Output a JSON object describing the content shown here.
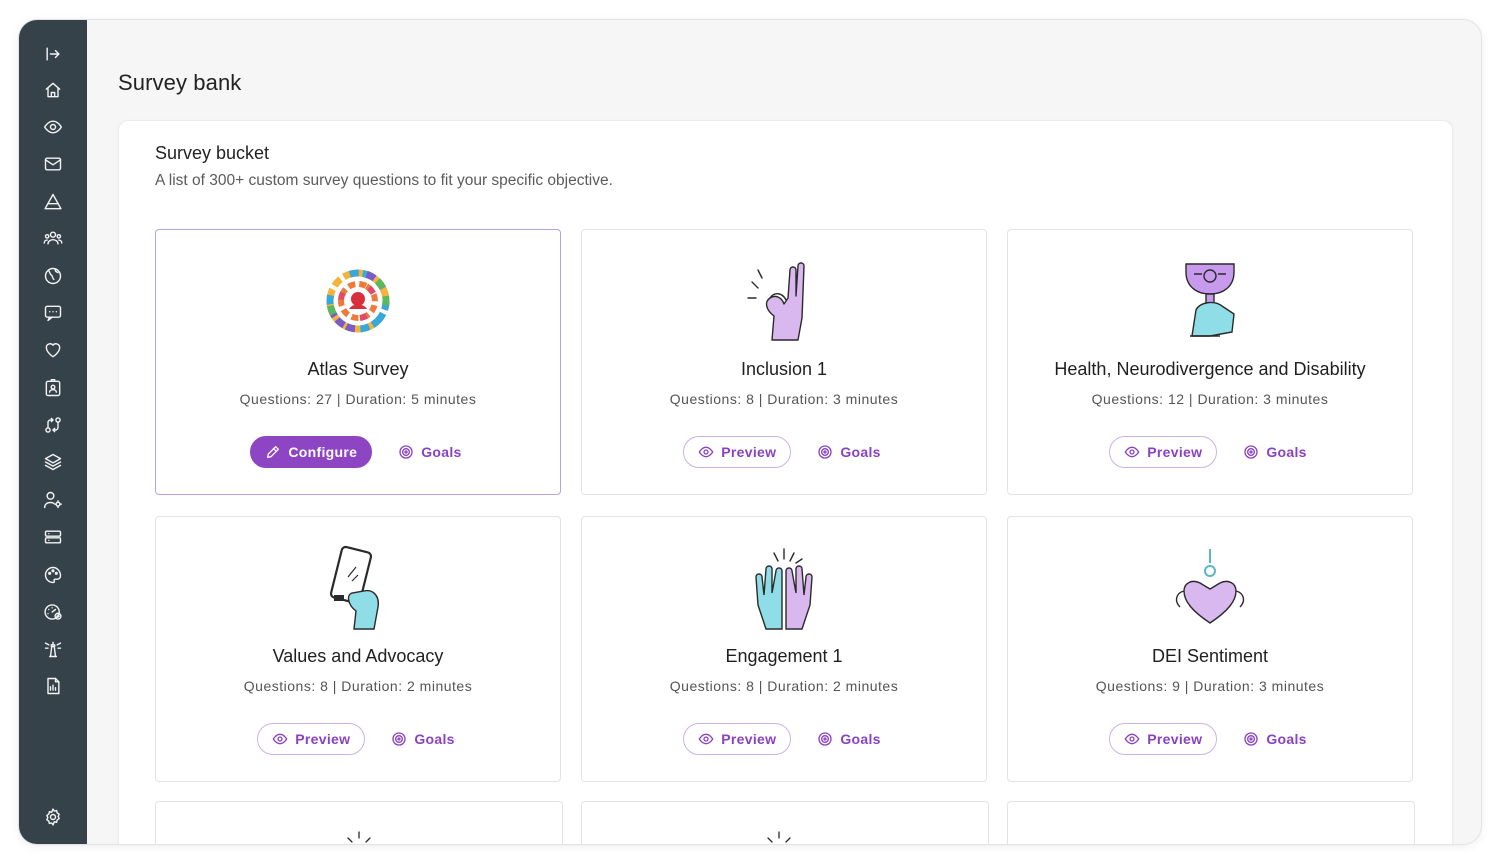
{
  "page": {
    "title": "Survey bank"
  },
  "panel": {
    "title": "Survey bucket",
    "subtitle": "A list of 300+ custom survey questions to fit your specific objective."
  },
  "colors": {
    "sidebar": "#36424a",
    "accent": "#8e45c4",
    "accent_outline": "#c9b3e6"
  },
  "sidebar": {
    "items": [
      {
        "icon": "expand-sidebar-icon"
      },
      {
        "icon": "home-icon"
      },
      {
        "icon": "eye-icon"
      },
      {
        "icon": "mail-icon"
      },
      {
        "icon": "triangle-icon"
      },
      {
        "icon": "people-icon"
      },
      {
        "icon": "globe-icon"
      },
      {
        "icon": "chat-icon"
      },
      {
        "icon": "heart-icon"
      },
      {
        "icon": "id-badge-icon"
      },
      {
        "icon": "route-icon"
      },
      {
        "icon": "layers-icon"
      },
      {
        "icon": "user-gear-icon"
      },
      {
        "icon": "database-icon"
      },
      {
        "icon": "palette-icon"
      },
      {
        "icon": "dashboard-add-icon"
      },
      {
        "icon": "lighthouse-icon"
      },
      {
        "icon": "report-icon"
      },
      {
        "icon": "settings-icon"
      }
    ]
  },
  "cards": [
    {
      "title": "Atlas Survey",
      "meta": "Questions: 27  |  Duration: 5 minutes",
      "primary_label": "Configure",
      "goals_label": "Goals",
      "illustration": "atlas-logo-icon"
    },
    {
      "title": "Inclusion 1",
      "meta": "Questions: 8  |  Duration: 3 minutes",
      "primary_label": "Preview",
      "goals_label": "Goals",
      "illustration": "ok-hand-icon"
    },
    {
      "title": "Health, Neurodivergence and Disability",
      "meta": "Questions: 12  |  Duration: 3 minutes",
      "primary_label": "Preview",
      "goals_label": "Goals",
      "illustration": "trophy-hand-icon"
    },
    {
      "title": "Values and Advocacy",
      "meta": "Questions: 8  |  Duration: 2 minutes",
      "primary_label": "Preview",
      "goals_label": "Goals",
      "illustration": "phone-hand-icon"
    },
    {
      "title": "Engagement 1",
      "meta": "Questions: 8  |  Duration: 2 minutes",
      "primary_label": "Preview",
      "goals_label": "Goals",
      "illustration": "high-five-icon"
    },
    {
      "title": "DEI Sentiment",
      "meta": "Questions: 9  |  Duration: 3 minutes",
      "primary_label": "Preview",
      "goals_label": "Goals",
      "illustration": "heart-hands-icon"
    }
  ]
}
